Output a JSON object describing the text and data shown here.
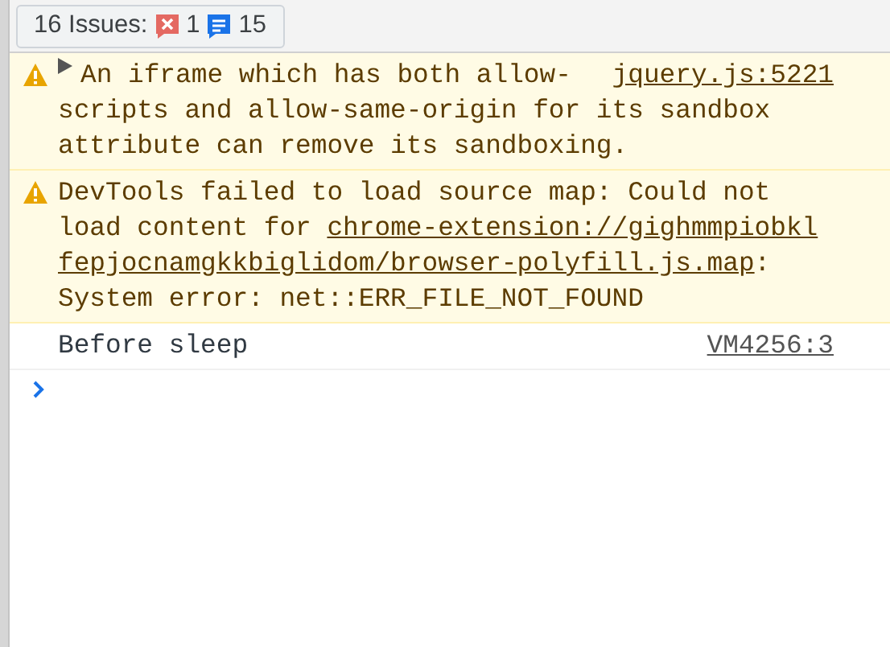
{
  "issues_button": {
    "label": "16 Issues:",
    "error_count": "1",
    "info_count": "15"
  },
  "messages": [
    {
      "kind": "warning",
      "expandable": true,
      "source": "jquery.js:5221",
      "lines": [
        [
          {
            "kind": "text",
            "text": "An iframe which has both allow-"
          }
        ],
        [
          {
            "kind": "text",
            "text": "scripts and allow-same-origin for its sandbox"
          }
        ],
        [
          {
            "kind": "text",
            "text": "attribute can remove its sandboxing."
          }
        ]
      ]
    },
    {
      "kind": "warning",
      "expandable": false,
      "lines": [
        [
          {
            "kind": "text",
            "text": "DevTools failed to load source map: Could not"
          }
        ],
        [
          {
            "kind": "text",
            "text": "load content for "
          },
          {
            "kind": "link",
            "text": "chrome-extension://gighmmpiobkl"
          }
        ],
        [
          {
            "kind": "link",
            "text": "fepjocnamgkkbiglidom/browser-polyfill.js.map"
          },
          {
            "kind": "text",
            "text": ":"
          }
        ],
        [
          {
            "kind": "text",
            "text": "System error: net::ERR_FILE_NOT_FOUND"
          }
        ]
      ]
    },
    {
      "kind": "log",
      "expandable": false,
      "source": "VM4256:3",
      "lines": [
        [
          {
            "kind": "text",
            "text": "Before sleep"
          }
        ]
      ]
    }
  ]
}
